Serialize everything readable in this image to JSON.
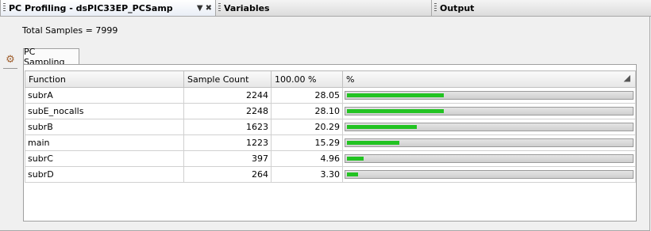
{
  "window_tabs": [
    {
      "label": "PC Profiling - dsPIC33EP_PCSamp",
      "active": true
    },
    {
      "label": "Variables",
      "active": false
    },
    {
      "label": "Output",
      "active": false
    }
  ],
  "summary": {
    "total_samples": "Total Samples = 7999"
  },
  "inner_tab": {
    "label": "PC Sampling"
  },
  "table": {
    "headers": [
      "Function",
      "Sample Count",
      "100.00 %",
      "%"
    ],
    "rows": [
      {
        "function": "subrA",
        "sample_count": "2244",
        "percent": "28.05",
        "fraction": 0.2805
      },
      {
        "function": "subE_nocalls",
        "sample_count": "2248",
        "percent": "28.10",
        "fraction": 0.281
      },
      {
        "function": "subrB",
        "sample_count": "1623",
        "percent": "20.29",
        "fraction": 0.2029
      },
      {
        "function": "main",
        "sample_count": "1223",
        "percent": "15.29",
        "fraction": 0.1529
      },
      {
        "function": "subrC",
        "sample_count": "397",
        "percent": "4.96",
        "fraction": 0.0496
      },
      {
        "function": "subrD",
        "sample_count": "264",
        "percent": "3.30",
        "fraction": 0.033
      }
    ]
  },
  "colors": {
    "bar_fill": "#22c322",
    "bar_track": "#d8d8d8"
  },
  "icons": {
    "tab_menu": "window-menu-icon",
    "tab_close": "close-icon",
    "side": "profiler-tool-icon",
    "sort": "sort-icon"
  }
}
